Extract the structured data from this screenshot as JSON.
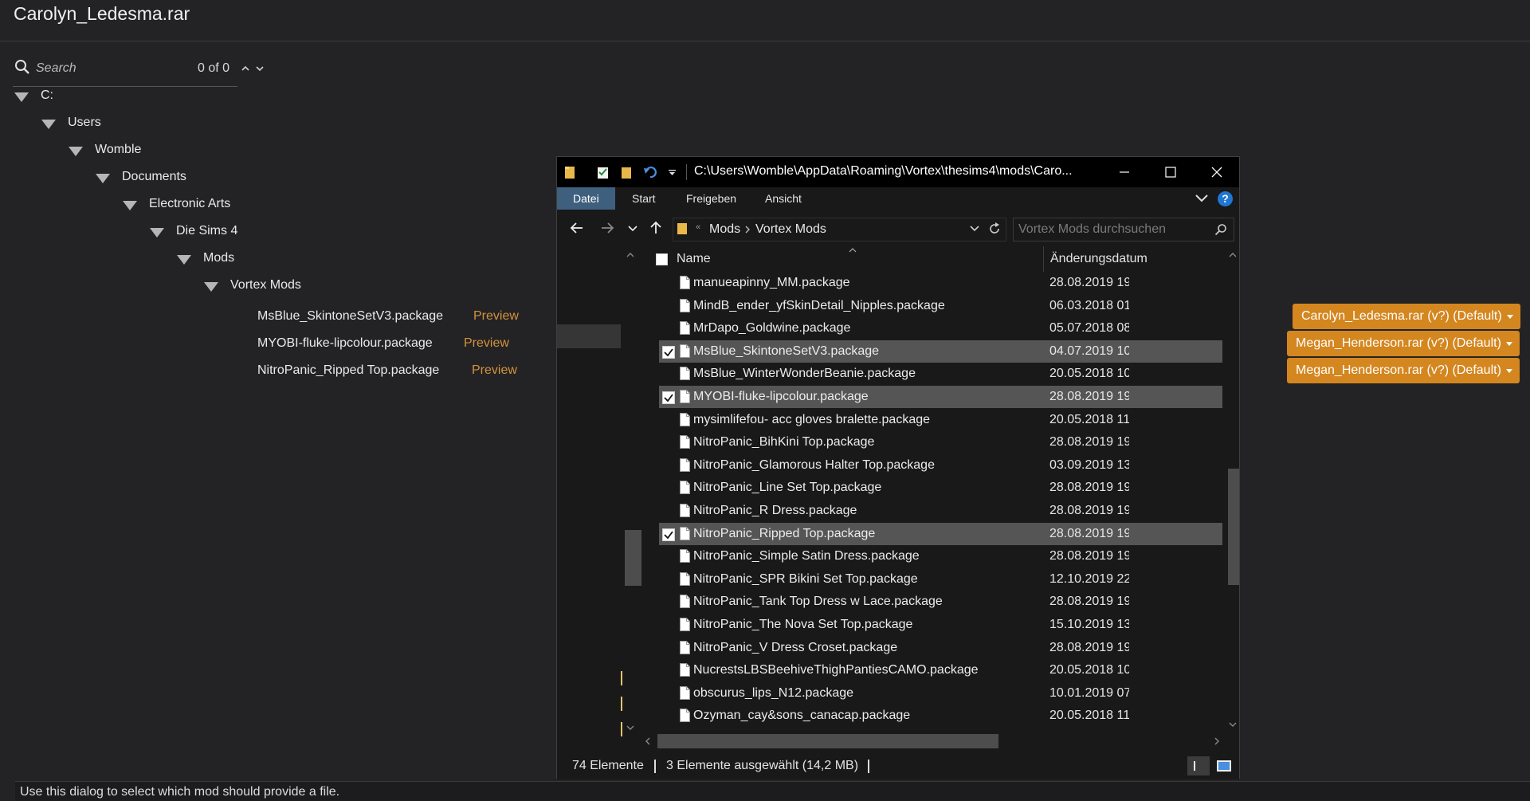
{
  "dialog": {
    "title": "Carolyn_Ledesma.rar",
    "hint": "Use this dialog to select which mod should provide a file."
  },
  "search": {
    "placeholder": "Search",
    "count": "0 of 0"
  },
  "tree": [
    "C:",
    "Users",
    "Womble",
    "Documents",
    "Electronic Arts",
    "Die Sims 4",
    "Mods",
    "Vortex Mods"
  ],
  "files": [
    {
      "name": "MsBlue_SkintoneSetV3.package",
      "preview": "Preview",
      "choice": "Carolyn_Ledesma.rar (v?) (Default)"
    },
    {
      "name": "MYOBI-fluke-lipcolour.package",
      "preview": "Preview",
      "choice": "Megan_Henderson.rar (v?) (Default)"
    },
    {
      "name": "NitroPanic_Ripped Top.package",
      "preview": "Preview",
      "choice": "Megan_Henderson.rar (v?) (Default)"
    }
  ],
  "explorer": {
    "path": "C:\\Users\\Womble\\AppData\\Roaming\\Vortex\\thesims4\\mods\\Caro...",
    "ribbon": [
      "Datei",
      "Start",
      "Freigeben",
      "Ansicht"
    ],
    "help": "?",
    "breadcrumb": [
      "Mods",
      "Vortex Mods"
    ],
    "search_placeholder": "Vortex Mods durchsuchen",
    "columns": {
      "name": "Name",
      "date": "Änderungsdatum"
    },
    "rows": [
      {
        "name": "manueapinny_MM.package",
        "date": "28.08.2019 19:",
        "selected": false
      },
      {
        "name": "MindB_ender_yfSkinDetail_Nipples.package",
        "date": "06.03.2018 01:",
        "selected": false
      },
      {
        "name": "MrDapo_Goldwine.package",
        "date": "05.07.2018 08:",
        "selected": false
      },
      {
        "name": "MsBlue_SkintoneSetV3.package",
        "date": "04.07.2019 10:",
        "selected": true
      },
      {
        "name": "MsBlue_WinterWonderBeanie.package",
        "date": "20.05.2018 10:",
        "selected": false
      },
      {
        "name": "MYOBI-fluke-lipcolour.package",
        "date": "28.08.2019 19:",
        "selected": true
      },
      {
        "name": "mysimlifefou- acc gloves bralette.package",
        "date": "20.05.2018 11:",
        "selected": false
      },
      {
        "name": "NitroPanic_BihKini Top.package",
        "date": "28.08.2019 19:",
        "selected": false
      },
      {
        "name": "NitroPanic_Glamorous Halter Top.package",
        "date": "03.09.2019 13:",
        "selected": false
      },
      {
        "name": "NitroPanic_Line Set Top.package",
        "date": "28.08.2019 19:",
        "selected": false
      },
      {
        "name": "NitroPanic_R Dress.package",
        "date": "28.08.2019 19:",
        "selected": false
      },
      {
        "name": "NitroPanic_Ripped Top.package",
        "date": "28.08.2019 19:",
        "selected": true
      },
      {
        "name": "NitroPanic_Simple Satin Dress.package",
        "date": "28.08.2019 19:",
        "selected": false
      },
      {
        "name": "NitroPanic_SPR Bikini Set Top.package",
        "date": "12.10.2019 22:",
        "selected": false
      },
      {
        "name": "NitroPanic_Tank Top Dress w Lace.package",
        "date": "28.08.2019 19:",
        "selected": false
      },
      {
        "name": "NitroPanic_The Nova Set Top.package",
        "date": "15.10.2019 13:",
        "selected": false
      },
      {
        "name": "NitroPanic_V Dress Croset.package",
        "date": "28.08.2019 19:",
        "selected": false
      },
      {
        "name": "NucrestsLBSBeehiveThighPantiesCAMO.package",
        "date": "20.05.2018 10:",
        "selected": false
      },
      {
        "name": "obscurus_lips_N12.package",
        "date": "10.01.2019 07:",
        "selected": false
      },
      {
        "name": "Ozyman_cay&sons_canacap.package",
        "date": "20.05.2018 11:",
        "selected": false
      }
    ],
    "status": {
      "count": "74 Elemente",
      "selection": "3 Elemente ausgewählt (14,2 MB)"
    }
  },
  "colors": {
    "accent": "#d4861f",
    "preview": "#d4923d",
    "background": "#232325",
    "ribbon_active": "#3f5f7e"
  }
}
